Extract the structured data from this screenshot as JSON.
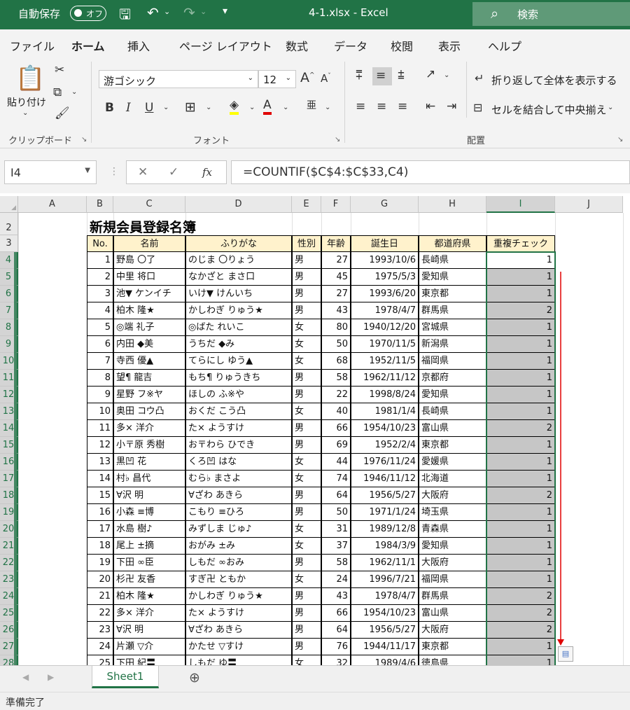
{
  "titlebar": {
    "autosave_label": "自動保存",
    "autosave_state": "オフ",
    "title": "4-1.xlsx  -  Excel",
    "search_label": "検索"
  },
  "menu": [
    "ファイル",
    "ホーム",
    "挿入",
    "ページ レイアウト",
    "数式",
    "データ",
    "校閲",
    "表示",
    "ヘルプ"
  ],
  "active_menu": "ホーム",
  "ribbon": {
    "paste_label": "貼り付け",
    "clipboard_label": "クリップボード",
    "font_name": "游ゴシック",
    "font_size": "12",
    "font_label": "フォント",
    "wrap_label": "折り返して全体を表示する",
    "merge_label": "セルを結合して中央揃え",
    "alignment_label": "配置"
  },
  "formula_bar": {
    "name_box": "I4",
    "formula": "=COUNTIF($C$4:$C$33,C4)"
  },
  "columns": [
    "A",
    "B",
    "C",
    "D",
    "E",
    "F",
    "G",
    "H",
    "I",
    "J"
  ],
  "selected_column": "I",
  "row_numbers": [
    "2",
    "3",
    "4",
    "5",
    "6",
    "7",
    "8",
    "9",
    "10",
    "11",
    "12",
    "13",
    "14",
    "15",
    "16",
    "17",
    "18",
    "19",
    "20",
    "21",
    "22",
    "23",
    "24",
    "25",
    "26",
    "27",
    "28"
  ],
  "sheet": {
    "title": "新規会員登録名簿",
    "headers": [
      "No.",
      "名前",
      "ふりがな",
      "性別",
      "年齢",
      "誕生日",
      "都道府県",
      "重複チェック"
    ],
    "rows": [
      [
        "1",
        "野島 〇了",
        "のじま 〇りょう",
        "男",
        "27",
        "1993/10/6",
        "長崎県",
        "1"
      ],
      [
        "2",
        "中里 将口",
        "なかざと まさ口",
        "男",
        "45",
        "1975/5/3",
        "愛知県",
        "1"
      ],
      [
        "3",
        "池▼ ケンイチ",
        "いけ▼ けんいち",
        "男",
        "27",
        "1993/6/20",
        "東京都",
        "1"
      ],
      [
        "4",
        "柏木 隆★",
        "かしわぎ りゅう★",
        "男",
        "43",
        "1978/4/7",
        "群馬県",
        "2"
      ],
      [
        "5",
        "◎端 礼子",
        "◎ばた れいこ",
        "女",
        "80",
        "1940/12/20",
        "宮城県",
        "1"
      ],
      [
        "6",
        "内田 ◆美",
        "うちだ ◆み",
        "女",
        "50",
        "1970/11/5",
        "新潟県",
        "1"
      ],
      [
        "7",
        "寺西 優▲",
        "てらにし ゆう▲",
        "女",
        "68",
        "1952/11/5",
        "福岡県",
        "1"
      ],
      [
        "8",
        "望¶ 龍吉",
        "もち¶ りゅうきち",
        "男",
        "58",
        "1962/11/12",
        "京都府",
        "1"
      ],
      [
        "9",
        "星野 フ※ヤ",
        "ほしの ふ※や",
        "男",
        "22",
        "1998/8/24",
        "愛知県",
        "1"
      ],
      [
        "10",
        "奥田 コウ凸",
        "おくだ こう凸",
        "女",
        "40",
        "1981/1/4",
        "長崎県",
        "1"
      ],
      [
        "11",
        "多× 洋介",
        "た× ようすけ",
        "男",
        "66",
        "1954/10/23",
        "富山県",
        "2"
      ],
      [
        "12",
        "小〒原 秀樹",
        "お〒わら ひでき",
        "男",
        "69",
        "1952/2/4",
        "東京都",
        "1"
      ],
      [
        "13",
        "黒凹 花",
        "くろ凹 はな",
        "女",
        "44",
        "1976/11/24",
        "愛媛県",
        "1"
      ],
      [
        "14",
        "村♭ 昌代",
        "むら♭ まさよ",
        "女",
        "74",
        "1946/11/12",
        "北海道",
        "1"
      ],
      [
        "15",
        "∀沢 明",
        "∀ざわ あきら",
        "男",
        "64",
        "1956/5/27",
        "大阪府",
        "2"
      ],
      [
        "16",
        "小森 ≡博",
        "こもり ≡ひろ",
        "男",
        "50",
        "1971/1/24",
        "埼玉県",
        "1"
      ],
      [
        "17",
        "水島 樹♪",
        "みずしま じゅ♪",
        "女",
        "31",
        "1989/12/8",
        "青森県",
        "1"
      ],
      [
        "18",
        "尾上 ±摘",
        "おがみ ±み",
        "女",
        "37",
        "1984/3/9",
        "愛知県",
        "1"
      ],
      [
        "19",
        "下田 ∞臣",
        "しもだ ∞おみ",
        "男",
        "58",
        "1962/11/1",
        "大阪府",
        "1"
      ],
      [
        "20",
        "杉卍 友香",
        "すぎ卍 ともか",
        "女",
        "24",
        "1996/7/21",
        "福岡県",
        "1"
      ],
      [
        "21",
        "柏木 隆★",
        "かしわぎ りゅう★",
        "男",
        "43",
        "1978/4/7",
        "群馬県",
        "2"
      ],
      [
        "22",
        "多× 洋介",
        "た× ようすけ",
        "男",
        "66",
        "1954/10/23",
        "富山県",
        "2"
      ],
      [
        "23",
        "∀沢 明",
        "∀ざわ あきら",
        "男",
        "64",
        "1956/5/27",
        "大阪府",
        "2"
      ],
      [
        "24",
        "片瀬 ▽介",
        "かたせ ▽すけ",
        "男",
        "76",
        "1944/11/17",
        "東京都",
        "1"
      ],
      [
        "25",
        "下田 紀〓",
        "しもだ ゆ〓",
        "女",
        "32",
        "1989/4/6",
        "徳島県",
        "1"
      ]
    ]
  },
  "sheet_tab": "Sheet1",
  "status": "準備完了",
  "colors": {
    "accent": "#217346",
    "selection": "#c6c6c6",
    "header_fill": "#fff2cc",
    "fill_arrow": "#e00000"
  }
}
